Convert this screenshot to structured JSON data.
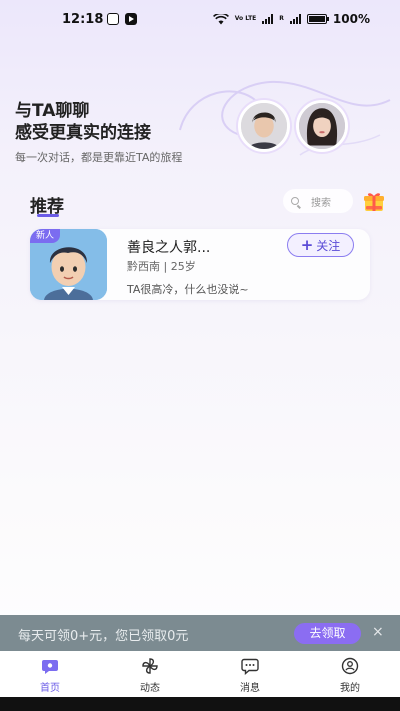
{
  "status": {
    "time": "12:18",
    "signal_label_1": "Vo LTE",
    "signal_label_2": "R",
    "battery": "100%"
  },
  "hero": {
    "title_line1": "与TA聊聊",
    "title_line2": "感受更真实的连接",
    "subtitle": "每一次对话，都是更靠近TA的旅程"
  },
  "section": {
    "title": "推荐",
    "search_placeholder": "搜索"
  },
  "card": {
    "badge": "新人",
    "name": "善良之人郭...",
    "meta": "黔西南 | 25岁",
    "desc": "TA很高冷，什么也没说~",
    "follow_label": "关注"
  },
  "promo": {
    "text": "每天可领0+元，您已领取0元",
    "button": "去领取",
    "close": "×"
  },
  "tabs": [
    {
      "label": "首页",
      "icon": "home-icon",
      "active": true
    },
    {
      "label": "动态",
      "icon": "pinwheel-icon",
      "active": false
    },
    {
      "label": "消息",
      "icon": "message-icon",
      "active": false
    },
    {
      "label": "我的",
      "icon": "profile-icon",
      "active": false
    }
  ],
  "colors": {
    "accent": "#6b5ce7",
    "promo_bg": "#7c8b91",
    "promo_button": "#8b6df2"
  }
}
